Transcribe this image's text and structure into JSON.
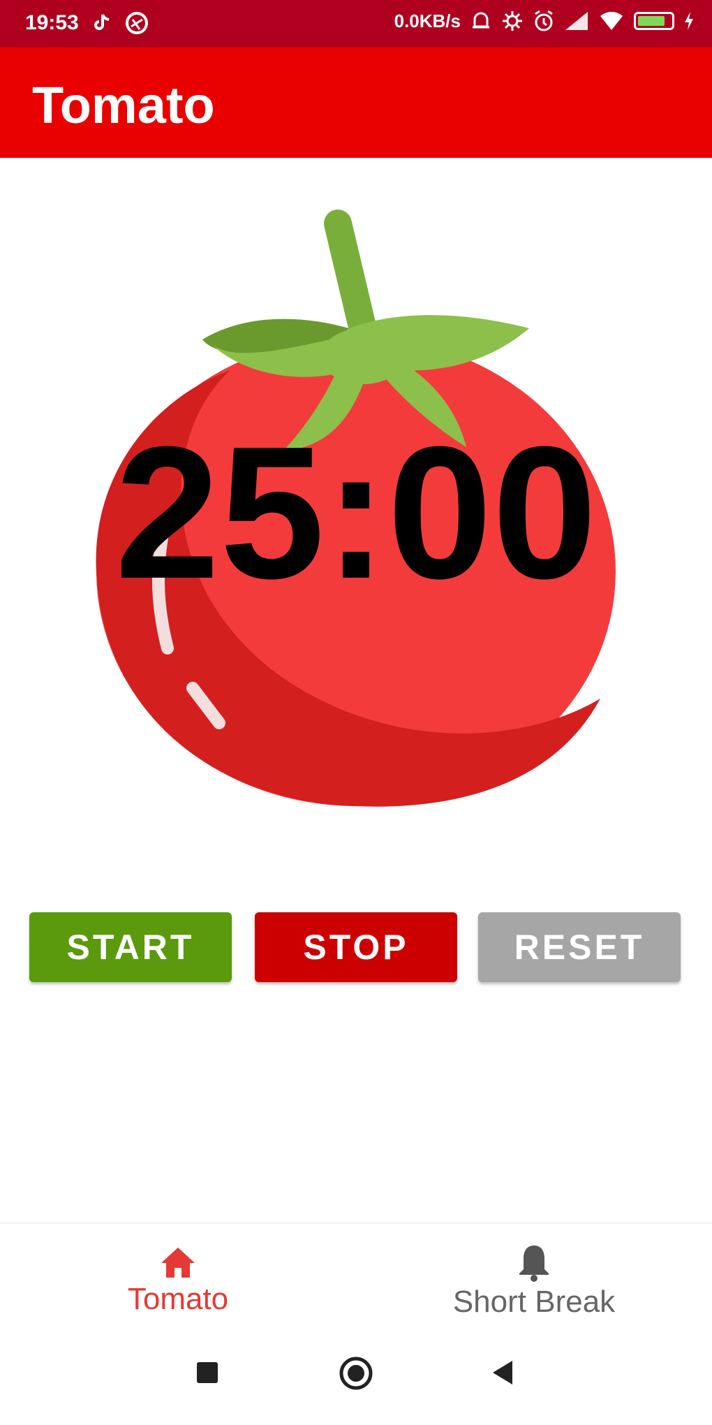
{
  "status_bar": {
    "time": "19:53",
    "network_speed": "0.0KB/s",
    "background": "#b00020",
    "battery_level": 0.85,
    "battery_color": "#7ed957"
  },
  "app_bar": {
    "title": "Tomato",
    "background": "#e90000"
  },
  "timer": {
    "display": "25:00"
  },
  "controls": {
    "start_label": "START",
    "stop_label": "STOP",
    "reset_label": "RESET",
    "start_color": "#5a9a0c",
    "stop_color": "#cc0000",
    "reset_color": "#a6a6a6"
  },
  "bottom_nav": {
    "items": [
      {
        "label": "Tomato",
        "icon": "home-icon",
        "active": true,
        "color": "#e53935"
      },
      {
        "label": "Short Break",
        "icon": "bell-icon",
        "active": false,
        "color": "#666666"
      }
    ]
  },
  "system_nav": {
    "icons": [
      "recent-apps-icon",
      "home-circle-icon",
      "back-icon"
    ]
  },
  "illustration": {
    "name": "tomato-icon",
    "body_color": "#f43b3c",
    "shadow_color": "#d41f1f",
    "leaf_color": "#8cc04a",
    "leaf_dark_color": "#6a9a2e"
  }
}
